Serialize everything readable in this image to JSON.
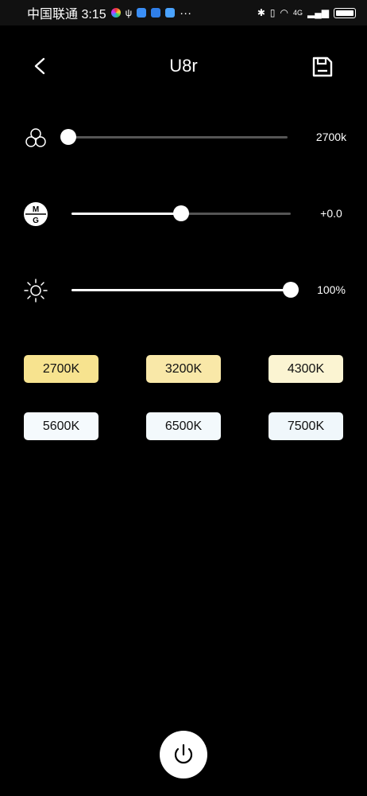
{
  "status_bar": {
    "carrier_time": "中国联通 3:15",
    "more": "···",
    "network": "4G"
  },
  "header": {
    "title": "U8r"
  },
  "sliders": [
    {
      "name": "color-temperature",
      "value_label": "2700k",
      "level": 0.0,
      "icon": "rgb-circles-icon"
    },
    {
      "name": "magenta-green",
      "value_label": "+0.0",
      "level": 0.5,
      "icon": "mg-badge-icon",
      "icon_top": "M",
      "icon_bottom": "G"
    },
    {
      "name": "brightness",
      "value_label": "100%",
      "level": 1.0,
      "icon": "sun-icon"
    }
  ],
  "presets": [
    {
      "label": "2700K",
      "color": "#f7e38f"
    },
    {
      "label": "3200K",
      "color": "#f9e8a8"
    },
    {
      "label": "4300K",
      "color": "#fbf4d2"
    },
    {
      "label": "5600K",
      "color": "#f5fafd"
    },
    {
      "label": "6500K",
      "color": "#f3f9fc"
    },
    {
      "label": "7500K",
      "color": "#f0f7fb"
    }
  ],
  "colors": {
    "background": "#000000",
    "track": "#555555",
    "accent": "#ffffff"
  }
}
